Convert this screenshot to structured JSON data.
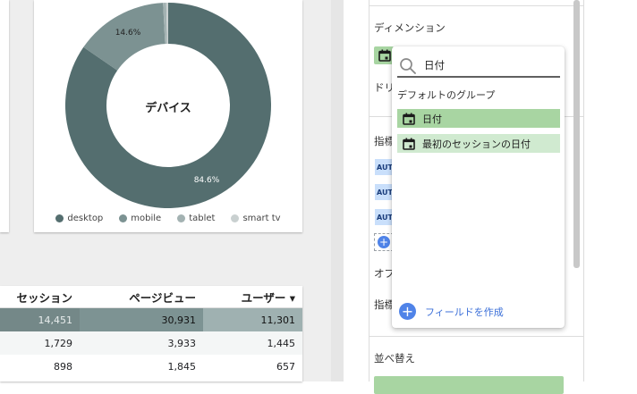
{
  "donut": {
    "center_label": "デバイス",
    "pct_large": "84.6%",
    "pct_small": "14.6%",
    "legend": [
      {
        "label": "desktop",
        "color": "#546e6f"
      },
      {
        "label": "mobile",
        "color": "#7c9292"
      },
      {
        "label": "tablet",
        "color": "#a3b2b2"
      },
      {
        "label": "smart tv",
        "color": "#c9d0d0"
      }
    ],
    "chart_data": {
      "type": "pie",
      "categories": [
        "desktop",
        "mobile",
        "tablet",
        "smart tv"
      ],
      "values": [
        84.6,
        14.6,
        0.5,
        0.3
      ],
      "title": "デバイス"
    }
  },
  "table": {
    "headers": [
      "セッション",
      "ページビュー",
      "ユーザー ▾"
    ],
    "rows": [
      [
        "14,451",
        "30,931",
        "11,301"
      ],
      [
        "1,729",
        "3,933",
        "1,445"
      ],
      [
        "898",
        "1,845",
        "657"
      ]
    ]
  },
  "panel": {
    "dimension_label": "ディメンション",
    "drill_label": "ドリ",
    "metric_label": "指標",
    "option_label": "オプ",
    "metric_label2": "指標",
    "sort_label": "並べ替え",
    "auto_badge": "AUT",
    "sort_value": "日付"
  },
  "dropdown": {
    "search_value": "日付",
    "group_label": "デフォルトのグループ",
    "items": [
      "日付",
      "最初のセッションの日付"
    ],
    "create_label": "フィールドを作成"
  },
  "colors": {
    "accent_blue": "#4f83e8",
    "chip_green": "#a8d5a2",
    "chip_green_light": "#d0ead0",
    "donut_dark": "#546e6f"
  }
}
